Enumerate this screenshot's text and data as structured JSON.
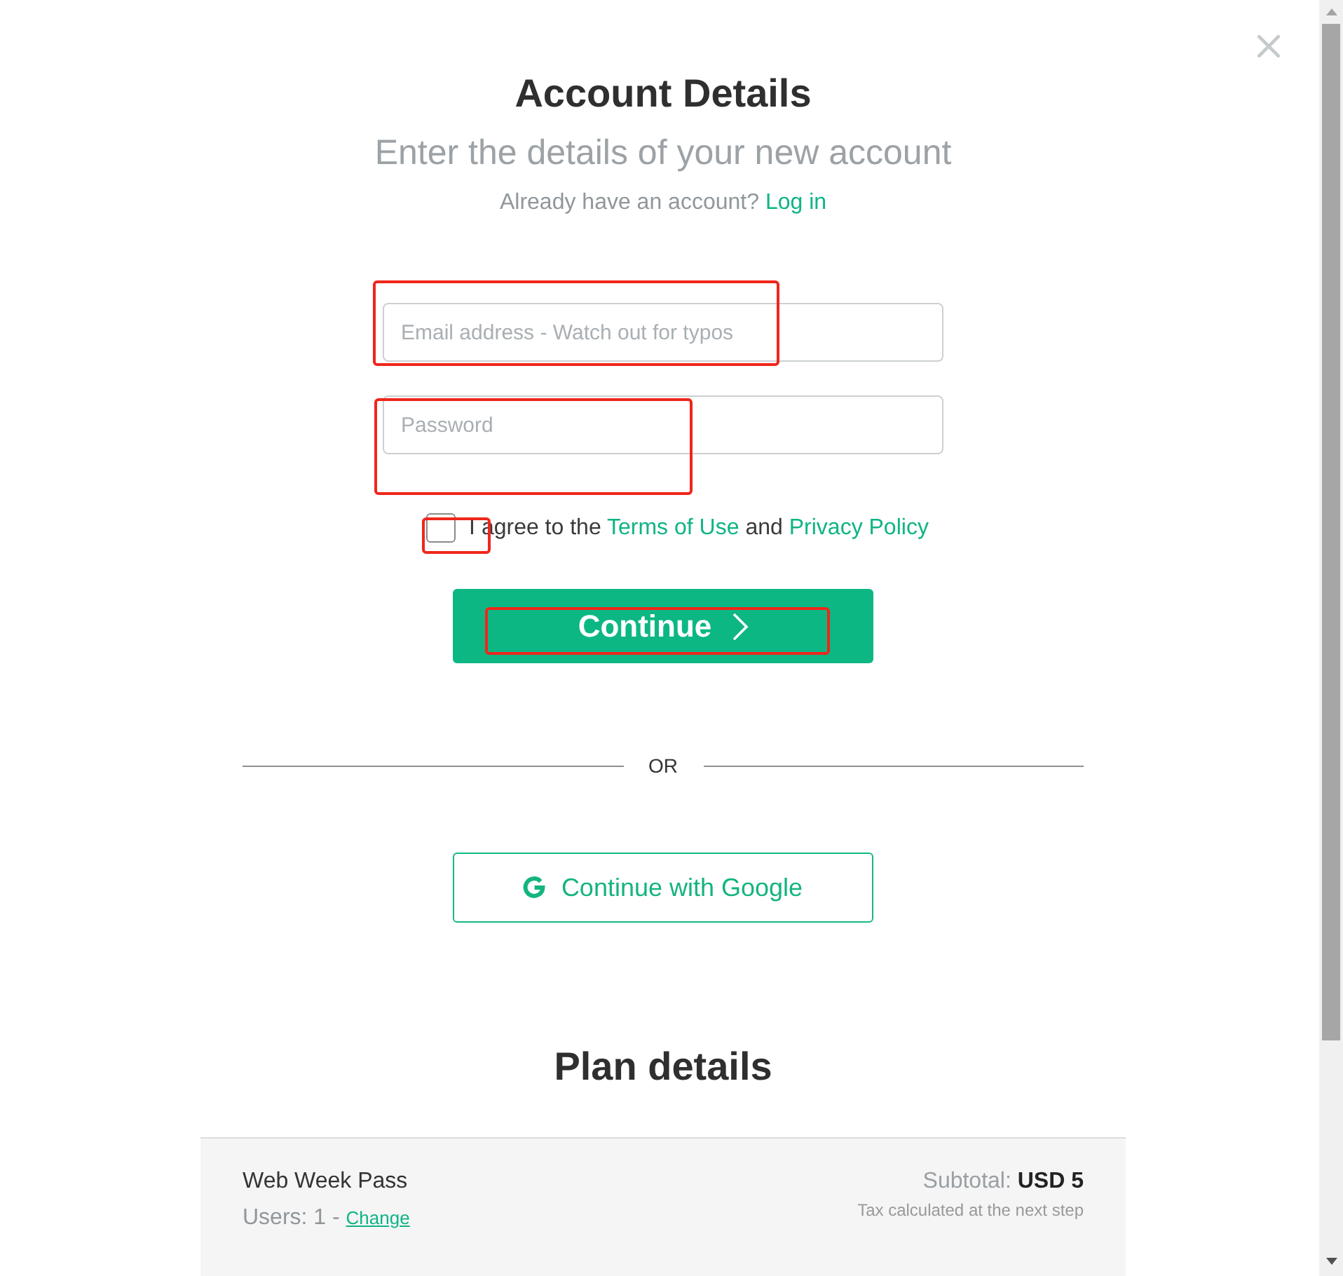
{
  "header": {
    "title": "Account Details",
    "subtitle": "Enter the details of your new account",
    "login_prompt": "Already have an account?",
    "login_link": "Log in"
  },
  "form": {
    "email": {
      "placeholder": "Email address - Watch out for typos",
      "highlighted": true
    },
    "password": {
      "placeholder": "Password",
      "highlighted": true
    },
    "terms": {
      "checked": false,
      "highlighted": true,
      "parts": [
        {
          "kind": "text",
          "text": "I agree to the"
        },
        {
          "kind": "link",
          "text": "Terms of Use"
        },
        {
          "kind": "text",
          "text": "and"
        },
        {
          "kind": "link",
          "text": "Privacy Policy"
        }
      ]
    },
    "continue_button": {
      "label": "Continue",
      "highlighted": true
    }
  },
  "divider": {
    "label": "OR"
  },
  "social_button": {
    "label": "Continue with Google"
  },
  "plan": {
    "title": "Plan details",
    "name": "Web Week Pass",
    "users": "Users: 1 -",
    "change_link": "Change",
    "subtotal": "Subtotal: **USD 5**",
    "tax_note": "Tax calculated at the next step"
  }
}
